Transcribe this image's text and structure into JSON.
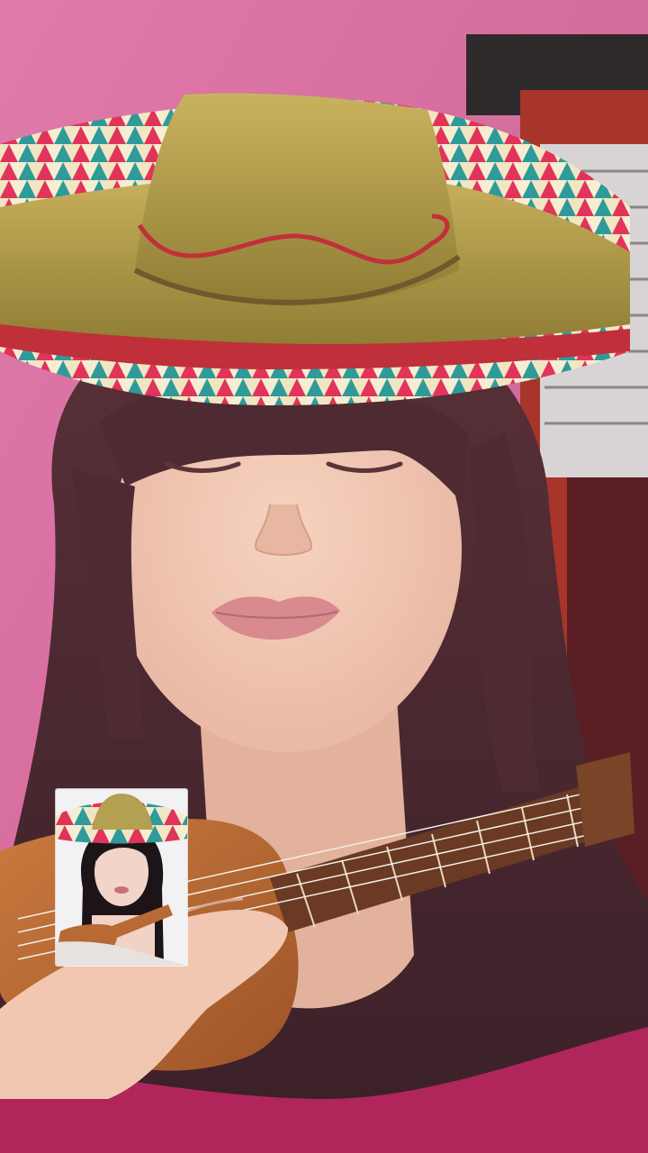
{
  "colors": {
    "background_wall": "#d9739f",
    "hair": "#4a2a30",
    "skin": "#f0c6b2",
    "shirt": "#b0265a",
    "hat_straw": "#b3a050",
    "hat_band": "#c0303a",
    "ukulele_body": "#b86a34",
    "fretboard": "#6a3a24"
  },
  "icons": {
    "hat": "sombrero-filter",
    "instrument": "ukulele-filter"
  }
}
